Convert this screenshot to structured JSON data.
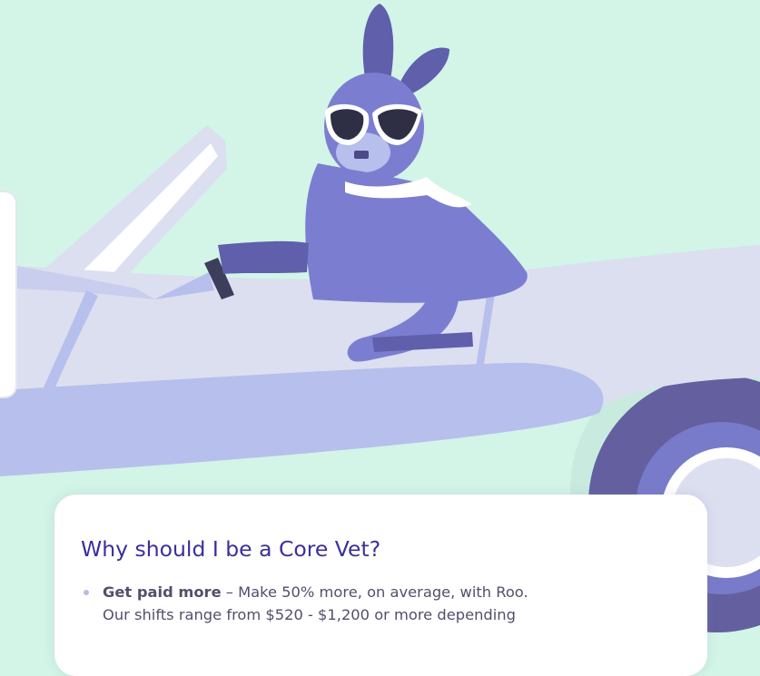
{
  "colors": {
    "background": "#d2f5e7",
    "car_body": "#dcdff0",
    "car_shadow": "#b7bfec",
    "kangaroo": "#7b7ed0",
    "kangaroo_dark": "#5f5fac",
    "wheel_dark": "#62619f",
    "title": "#3c2f9a",
    "body_text": "#524f6b",
    "bullet": "#b3bced"
  },
  "card": {
    "title": "Why should I be a Core Vet?",
    "benefits": [
      {
        "strong": "Get paid more",
        "text_line1": " – Make 50% more, on average, with Roo.",
        "text_line2": "Our shifts range from $520 - $1,200 or more depending"
      }
    ]
  }
}
